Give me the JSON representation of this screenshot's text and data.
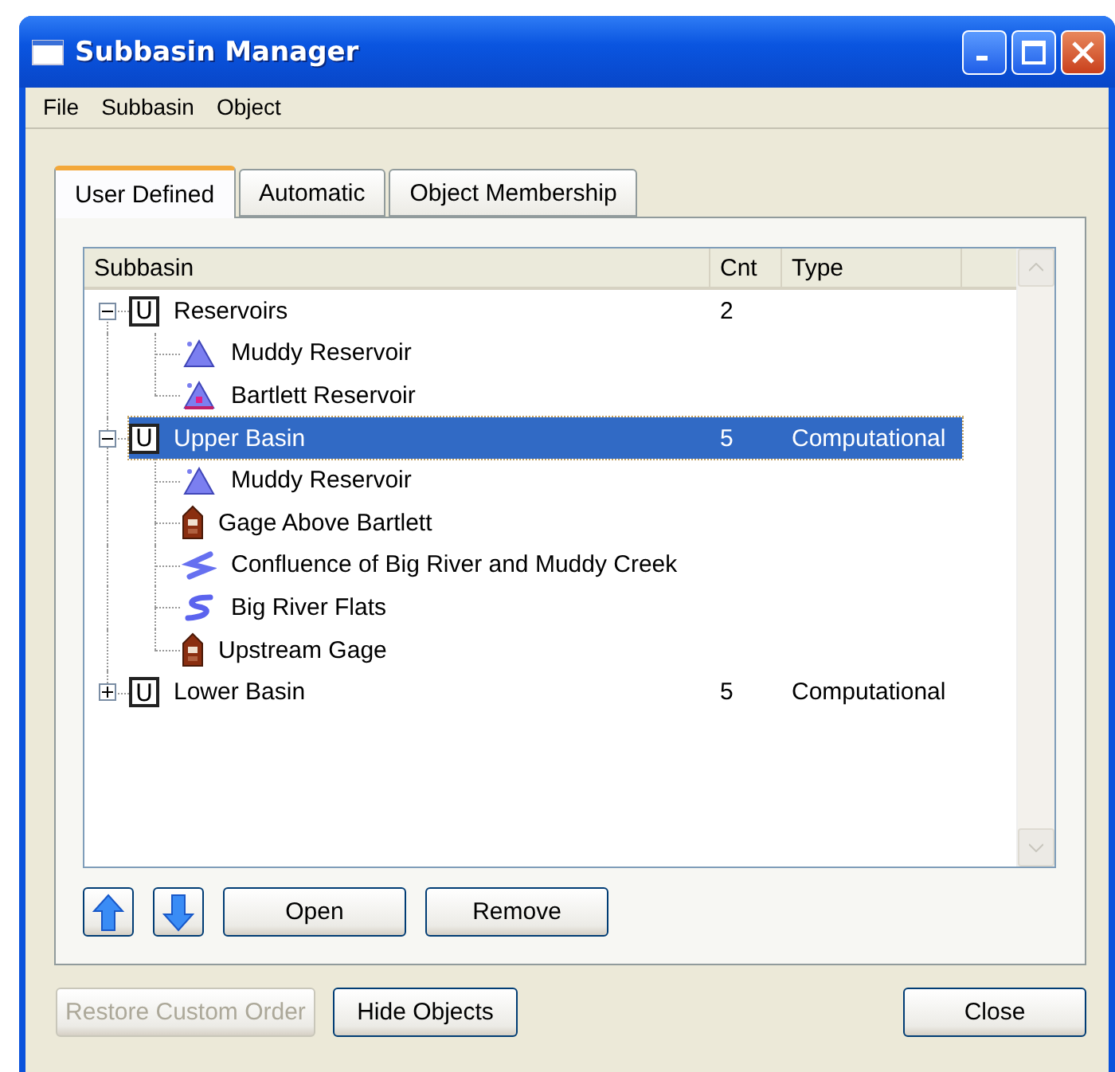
{
  "window": {
    "title": "Subbasin Manager"
  },
  "menu": [
    "File",
    "Subbasin",
    "Object"
  ],
  "tabs": [
    {
      "label": "User Defined",
      "selected": true
    },
    {
      "label": "Automatic",
      "selected": false
    },
    {
      "label": "Object Membership",
      "selected": false
    }
  ],
  "table": {
    "columns": [
      "Subbasin",
      "Cnt",
      "Type"
    ],
    "rows": [
      {
        "badge": "U",
        "name": "Reservoirs",
        "count": "2",
        "expanded": true,
        "selected": false,
        "children": [
          {
            "name": "Muddy Reservoir",
            "kind": "reservoir"
          },
          {
            "name": "Bartlett Reservoir",
            "kind": "reservoir-marked"
          }
        ]
      },
      {
        "badge": "U",
        "name": "Upper Basin",
        "count": "5",
        "type": "Computational",
        "expanded": true,
        "selected": true,
        "children": [
          {
            "name": "Muddy Reservoir",
            "kind": "reservoir"
          },
          {
            "name": "Gage Above Bartlett",
            "kind": "gage"
          },
          {
            "name": "Confluence of Big River and Muddy Creek",
            "kind": "junction"
          },
          {
            "name": "Big River Flats",
            "kind": "reach"
          },
          {
            "name": "Upstream Gage",
            "kind": "gage"
          }
        ]
      },
      {
        "badge": "U",
        "name": "Lower Basin",
        "count": "5",
        "type": "Computational",
        "expanded": false,
        "selected": false,
        "children": []
      }
    ]
  },
  "list_buttons": [
    {
      "kind": "up"
    },
    {
      "kind": "down"
    },
    {
      "kind": "text",
      "label": "Open"
    },
    {
      "kind": "text",
      "label": "Remove"
    }
  ],
  "footer_buttons": [
    {
      "label": "Restore Custom Order",
      "disabled": true
    },
    {
      "label": "Hide Objects",
      "disabled": false
    },
    {
      "label": "Close",
      "disabled": false
    }
  ]
}
